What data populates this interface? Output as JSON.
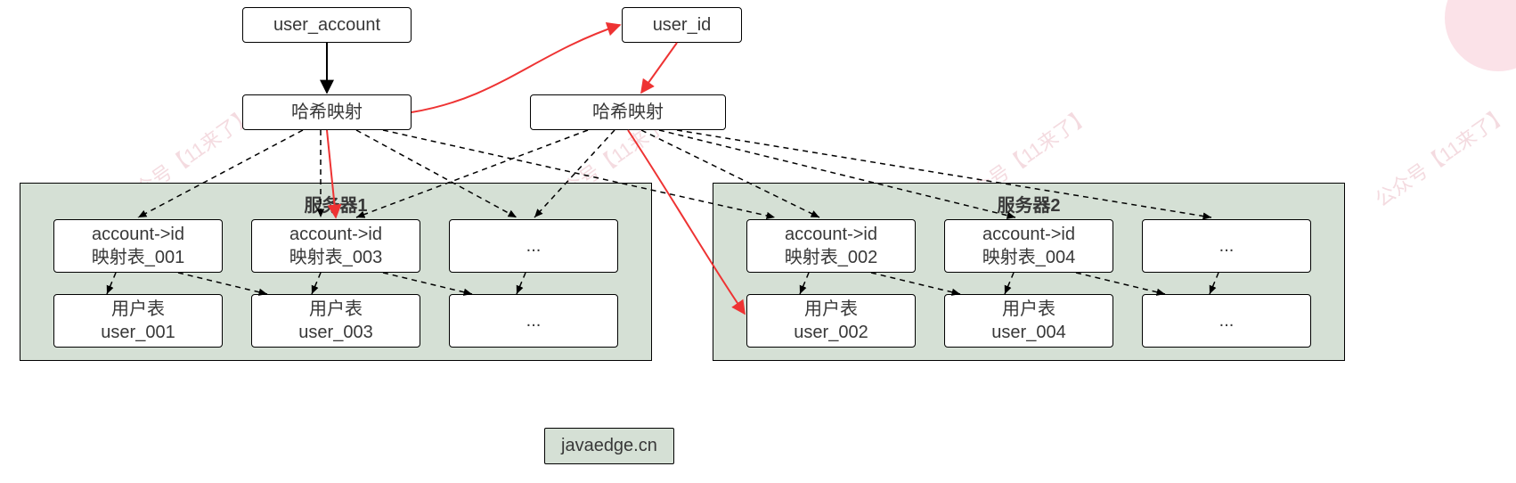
{
  "diagram": {
    "top_left_node": "user_account",
    "top_right_node": "user_id",
    "hash_left": "哈希映射",
    "hash_right": "哈希映射",
    "server1": {
      "title": "服务器1",
      "row1": [
        "account->id\n映射表_001",
        "account->id\n映射表_003",
        "..."
      ],
      "row2": [
        "用户表\nuser_001",
        "用户表\nuser_003",
        "..."
      ]
    },
    "server2": {
      "title": "服务器2",
      "row1": [
        "account->id\n映射表_002",
        "account->id\n映射表_004",
        "..."
      ],
      "row2": [
        "用户表\nuser_002",
        "用户表\nuser_004",
        "..."
      ]
    },
    "footer": "javaedge.cn",
    "watermark": "公众号【11来了】"
  },
  "edges": {
    "solid_black": [
      {
        "from": "user_account",
        "to": "hash_left"
      }
    ],
    "solid_red": [
      {
        "from": "hash_left",
        "to": "user_id",
        "curve": true
      },
      {
        "from": "user_id",
        "to": "hash_right"
      },
      {
        "from": "hash_left",
        "to": "server1.row1[1]"
      },
      {
        "from": "hash_right",
        "to": "server2.row2[0]",
        "curve": true
      }
    ],
    "dashed_black_from_hash_left": [
      "server1.row1[0]",
      "server1.row1[1]",
      "server1.row1[2]",
      "server2.row1[0]"
    ],
    "dashed_black_from_hash_right": [
      "server1.row1[1]",
      "server1.row1[2]",
      "server2.row1[0]",
      "server2.row1[1]",
      "server2.row1[2]"
    ],
    "dashed_row1_to_row2": [
      [
        "server1.row1[0]",
        "server1.row2[0]"
      ],
      [
        "server1.row1[0]",
        "server1.row2[1]"
      ],
      [
        "server1.row1[1]",
        "server1.row2[1]"
      ],
      [
        "server1.row1[1]",
        "server1.row2[2]"
      ],
      [
        "server1.row1[2]",
        "server1.row2[2]"
      ],
      [
        "server2.row1[0]",
        "server2.row2[0]"
      ],
      [
        "server2.row1[0]",
        "server2.row2[1]"
      ],
      [
        "server2.row1[1]",
        "server2.row2[1]"
      ],
      [
        "server2.row1[1]",
        "server2.row2[2]"
      ],
      [
        "server2.row1[2]",
        "server2.row2[2]"
      ]
    ]
  }
}
